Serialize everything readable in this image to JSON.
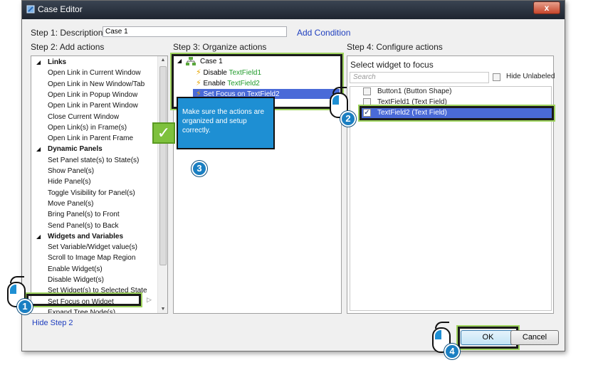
{
  "window": {
    "title": "Case Editor",
    "close_label": "x"
  },
  "step1": {
    "label": "Step 1: Description",
    "value": "Case 1",
    "add_condition": "Add Condition"
  },
  "step2": {
    "label": "Step 2: Add actions",
    "items": [
      {
        "label": "Links",
        "group": true
      },
      {
        "label": "Open Link in Current Window"
      },
      {
        "label": "Open Link in New Window/Tab"
      },
      {
        "label": "Open Link in Popup Window"
      },
      {
        "label": "Open Link in Parent Window"
      },
      {
        "label": "Close Current Window"
      },
      {
        "label": "Open Link(s) in Frame(s)"
      },
      {
        "label": "Open Link in Parent Frame"
      },
      {
        "label": "Dynamic Panels",
        "group": true
      },
      {
        "label": "Set Panel state(s) to State(s)"
      },
      {
        "label": "Show Panel(s)"
      },
      {
        "label": "Hide Panel(s)"
      },
      {
        "label": "Toggle Visibility for Panel(s)"
      },
      {
        "label": "Move Panel(s)"
      },
      {
        "label": "Bring Panel(s) to Front"
      },
      {
        "label": "Send Panel(s) to Back"
      },
      {
        "label": "Widgets and Variables",
        "group": true
      },
      {
        "label": "Set Variable/Widget value(s)"
      },
      {
        "label": "Scroll to Image Map Region"
      },
      {
        "label": "Enable Widget(s)"
      },
      {
        "label": "Disable Widget(s)"
      },
      {
        "label": "Set Widget(s) to Selected State"
      },
      {
        "label": "Set Focus on Widget",
        "highlight": true
      },
      {
        "label": "Expand Tree Node(s)"
      }
    ],
    "hide_link": "Hide Step 2"
  },
  "step3": {
    "label": "Step 3: Organize actions",
    "case_name": "Case 1",
    "actions": [
      {
        "verb": "Disable ",
        "target": "TextField1"
      },
      {
        "verb": "Enable ",
        "target": "TextField2"
      },
      {
        "verb": "Set Focus on TextField2",
        "target": ""
      }
    ]
  },
  "step4": {
    "label": "Step 4: Configure actions",
    "select_label": "Select widget to focus",
    "search_placeholder": "Search",
    "hide_unlabeled": "Hide Unlabeled",
    "widgets": [
      {
        "label": "Button1 (Button Shape)",
        "checked": false
      },
      {
        "label": "TextField1 (Text Field)",
        "checked": false
      },
      {
        "label": "TextField2 (Text Field)",
        "checked": true
      }
    ]
  },
  "callout": {
    "text": "Make sure the actions are organized and setup correctly."
  },
  "badges": [
    "1",
    "2",
    "3",
    "4"
  ],
  "footer": {
    "ok": "OK",
    "cancel": "Cancel"
  },
  "colors": {
    "accent": "#1e8fd3",
    "selection": "#4a6ad8",
    "highlight": "#9ed35d",
    "link": "#1f3fbf"
  }
}
